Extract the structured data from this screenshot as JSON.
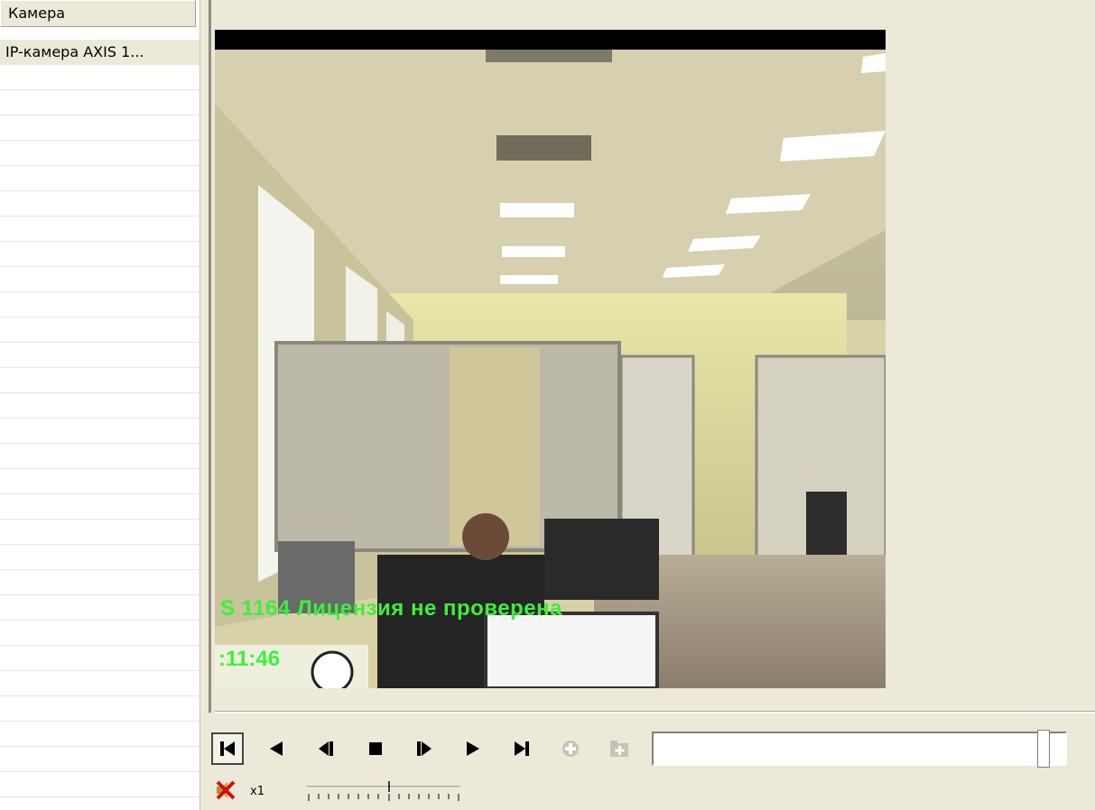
{
  "camera_list": {
    "header": "Камера",
    "items": [
      "IP-камера AXIS 1..."
    ]
  },
  "video": {
    "overlay_license": "S 1164  Лицензия не проверена",
    "overlay_time": ":11:46"
  },
  "controls": {
    "buttons": [
      {
        "name": "go-to-start-button",
        "icon": "skip-to-start-icon"
      },
      {
        "name": "play-backward-button",
        "icon": "play-backward-icon"
      },
      {
        "name": "step-backward-button",
        "icon": "step-backward-icon"
      },
      {
        "name": "stop-button",
        "icon": "stop-icon"
      },
      {
        "name": "step-forward-button",
        "icon": "step-forward-icon"
      },
      {
        "name": "play-forward-button",
        "icon": "play-forward-icon"
      },
      {
        "name": "go-to-end-button",
        "icon": "skip-to-end-icon"
      },
      {
        "name": "record-button",
        "icon": "record-icon"
      },
      {
        "name": "add-bookmark-button",
        "icon": "add-folder-icon"
      }
    ],
    "speed_label": "x1",
    "sound_state": "muted"
  },
  "colors": {
    "overlay_text": "#3cf03c",
    "window_bg": "#ece9d8"
  }
}
